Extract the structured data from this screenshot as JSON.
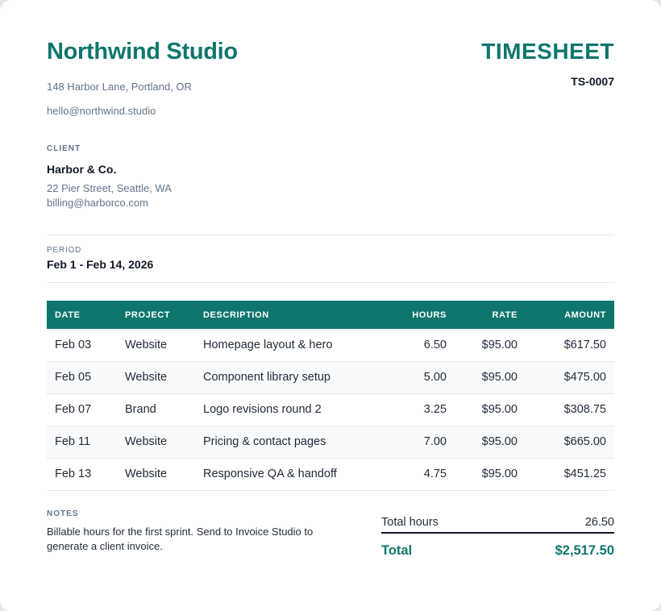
{
  "company": {
    "name": "Northwind Studio",
    "address": "148 Harbor Lane, Portland, OR",
    "email": "hello@northwind.studio"
  },
  "document": {
    "title": "TIMESHEET",
    "number": "TS-0007"
  },
  "client": {
    "label": "CLIENT",
    "name": "Harbor & Co.",
    "address": "22 Pier Street, Seattle, WA",
    "email": "billing@harborco.com"
  },
  "period": {
    "label": "PERIOD",
    "value": "Feb 1 - Feb 14, 2026"
  },
  "table": {
    "headers": {
      "date": "DATE",
      "project": "PROJECT",
      "description": "DESCRIPTION",
      "hours": "HOURS",
      "rate": "RATE",
      "amount": "AMOUNT"
    },
    "rows": [
      {
        "date": "Feb 03",
        "project": "Website",
        "description": "Homepage layout & hero",
        "hours": "6.50",
        "rate": "$95.00",
        "amount": "$617.50"
      },
      {
        "date": "Feb 05",
        "project": "Website",
        "description": "Component library setup",
        "hours": "5.00",
        "rate": "$95.00",
        "amount": "$475.00"
      },
      {
        "date": "Feb 07",
        "project": "Brand",
        "description": "Logo revisions round 2",
        "hours": "3.25",
        "rate": "$95.00",
        "amount": "$308.75"
      },
      {
        "date": "Feb 11",
        "project": "Website",
        "description": "Pricing & contact pages",
        "hours": "7.00",
        "rate": "$95.00",
        "amount": "$665.00"
      },
      {
        "date": "Feb 13",
        "project": "Website",
        "description": "Responsive QA & handoff",
        "hours": "4.75",
        "rate": "$95.00",
        "amount": "$451.25"
      }
    ]
  },
  "notes": {
    "label": "NOTES",
    "text": "Billable hours for the first sprint. Send to Invoice Studio to generate a client invoice."
  },
  "totals": {
    "hours_label": "Total hours",
    "hours_value": "26.50",
    "total_label": "Total",
    "total_value": "$2,517.50"
  },
  "colors": {
    "accent": "#0f766e",
    "text": "#111827",
    "muted": "#64748b"
  }
}
